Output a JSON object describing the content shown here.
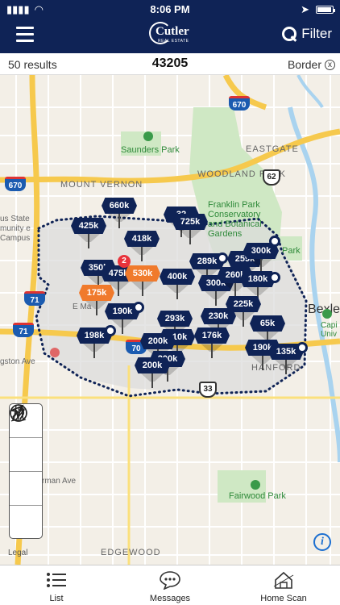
{
  "status_bar": {
    "time": "8:06 PM"
  },
  "header": {
    "logo_name": "Cutler",
    "logo_sub": "REAL ESTATE",
    "filter_label": "Filter"
  },
  "results_bar": {
    "count": "50 results",
    "zip": "43205",
    "border_label": "Border",
    "border_clear": "x"
  },
  "map": {
    "labels": {
      "saunders_park": "Saunders Park",
      "eastgate": "EASTGATE",
      "woodland_park": "WOODLAND PARK",
      "mount_vernon": "MOUNT VERNON",
      "franklin_park": "Franklin Park Conservatory and Botanical Gardens",
      "park": "Park",
      "bexley": "Bexle",
      "hanford": "HANFORD",
      "capital": "Capi Univ",
      "fairwood_park": "Fairwood Park",
      "edgewood": "EDGEWOOD",
      "herman_ave": "rman Ave",
      "kingston_ave": "gston Ave",
      "state_community": "us State munity e Campus",
      "e_main": "E Ma"
    },
    "shields": {
      "i670_left": "670",
      "i670_top": "670",
      "i71_a": "71",
      "i71_b": "71",
      "i70": "70",
      "us62": "62",
      "us33": "33"
    },
    "cluster_count": "2",
    "pins": [
      {
        "label": "660k",
        "color": "navy"
      },
      {
        "label": "425k",
        "color": "navy"
      },
      {
        "label": "32",
        "color": "navy"
      },
      {
        "label": "725k",
        "color": "navy"
      },
      {
        "label": "418k",
        "color": "navy"
      },
      {
        "label": "350k",
        "color": "navy"
      },
      {
        "label": "475k",
        "color": "navy"
      },
      {
        "label": "530k",
        "color": "orange"
      },
      {
        "label": "400k",
        "color": "navy"
      },
      {
        "label": "289k",
        "color": "navy"
      },
      {
        "label": "259k",
        "color": "navy"
      },
      {
        "label": "300k",
        "color": "navy"
      },
      {
        "label": "300k",
        "color": "navy"
      },
      {
        "label": "260k",
        "color": "navy"
      },
      {
        "label": "180k",
        "color": "navy"
      },
      {
        "label": "175k",
        "color": "orange"
      },
      {
        "label": "190k",
        "color": "navy"
      },
      {
        "label": "225k",
        "color": "navy"
      },
      {
        "label": "230k",
        "color": "navy"
      },
      {
        "label": "293k",
        "color": "navy"
      },
      {
        "label": "198k",
        "color": "navy"
      },
      {
        "label": "210k",
        "color": "navy"
      },
      {
        "label": "176k",
        "color": "navy"
      },
      {
        "label": "65k",
        "color": "navy"
      },
      {
        "label": "200k",
        "color": "navy"
      },
      {
        "label": "200k",
        "color": "navy"
      },
      {
        "label": "200k",
        "color": "navy"
      },
      {
        "label": "190k",
        "color": "navy"
      },
      {
        "label": "135k",
        "color": "navy"
      }
    ],
    "legal": "Legal",
    "info": "i"
  },
  "tools": [
    "location-arrow-icon",
    "pencil-draw-icon",
    "road-icon",
    "globe-icon"
  ],
  "tabbar": {
    "list": "List",
    "messages": "Messages",
    "home_scan": "Home Scan"
  },
  "colors": {
    "navy": "#0f2356",
    "orange": "#f07a2c",
    "park_green": "#cfe8c4",
    "highway": "#f6c94d"
  }
}
